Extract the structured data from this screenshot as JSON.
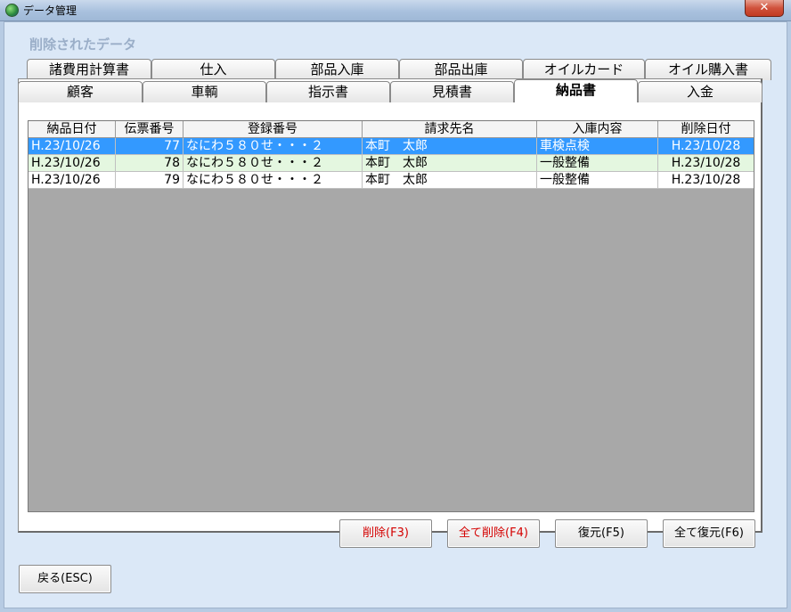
{
  "window": {
    "title": "データ管理",
    "close_label": "✕"
  },
  "group_title": "削除されたデータ",
  "tabs_row1": [
    "諸費用計算書",
    "仕入",
    "部品入庫",
    "部品出庫",
    "オイルカード",
    "オイル購入書"
  ],
  "tabs_row2": [
    "顧客",
    "車輌",
    "指示書",
    "見積書",
    "納品書",
    "入金"
  ],
  "active_tab": "納品書",
  "table": {
    "columns": [
      "納品日付",
      "伝票番号",
      "登録番号",
      "請求先名",
      "入庫内容",
      "削除日付"
    ],
    "rows": [
      {
        "date": "H.23/10/26",
        "no": "77",
        "reg": "なにわ５８０せ・・・２",
        "customer": "本町　太郎",
        "content": "車検点検",
        "deleted": "H.23/10/28"
      },
      {
        "date": "H.23/10/26",
        "no": "78",
        "reg": "なにわ５８０せ・・・２",
        "customer": "本町　太郎",
        "content": "一般整備",
        "deleted": "H.23/10/28"
      },
      {
        "date": "H.23/10/26",
        "no": "79",
        "reg": "なにわ５８０せ・・・２",
        "customer": "本町　太郎",
        "content": "一般整備",
        "deleted": "H.23/10/28"
      }
    ]
  },
  "buttons": {
    "delete": "削除(F3)",
    "delete_all": "全て削除(F4)",
    "restore": "復元(F5)",
    "restore_all": "全て復元(F6)",
    "back": "戻る(ESC)"
  }
}
